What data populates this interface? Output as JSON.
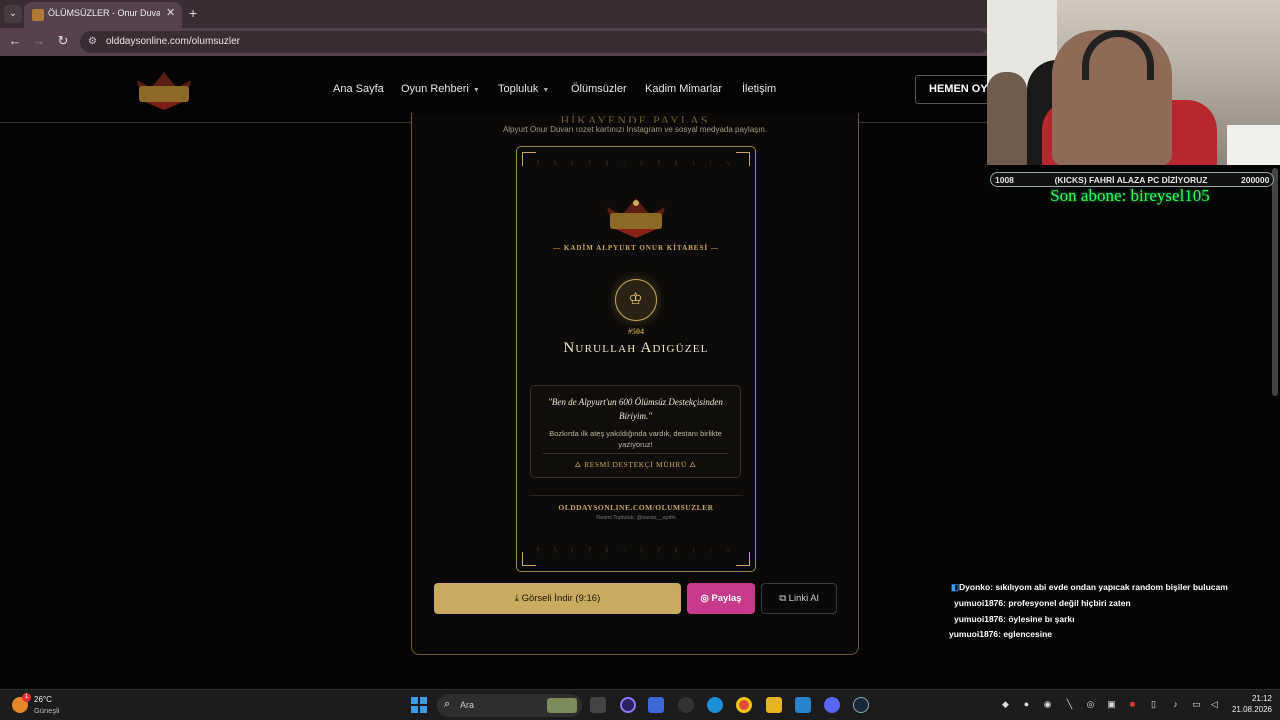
{
  "browser": {
    "tab_title": "ÖLÜMSÜZLER - Onur Duvarı | O",
    "url": "olddaysonline.com/olumsuzler",
    "new_tab_symbol": "+",
    "close_symbol": "✕"
  },
  "site_nav": {
    "logo_text": "OLD DAYS",
    "links": [
      "Ana Sayfa",
      "Oyun Rehberi",
      "Topluluk",
      "Ölümsüzler",
      "Kadim Mimarlar",
      "İletişim"
    ],
    "play_button": "HEMEN OYNA"
  },
  "share_section": {
    "heading": "HİKAYENDE PAYLAŞ",
    "description": "Alpyurt Onur Duvarı rozet kartınızı Instagram ve sosyal medyada paylaşın."
  },
  "card": {
    "logo_text": "OLD DAYS",
    "subtitle": "— KADİM ALPYURT ONUR KİTABESİ —",
    "crown_icon": "♔",
    "member_number": "#504",
    "member_name": "Nurullah Adigüzel",
    "quote": "\"Ben de Alpyurt'un 600 Ölümsüz Destekçisinden Biriyim.\"",
    "quote_sub": "Bozkırda ilk ateş yakıldığında vardık, destanı birlikte yazıyoruz!",
    "seal": "🜂 RESMİ DESTEKÇİ MÜHRÜ 🜂",
    "url": "OLDDAYSONLINE.COM/OLUMSUZLER",
    "community": "Resmi Topluluk: @savas__aydin",
    "runes": "ᚠ ᚢ ᚦ ᚨ ᚱ ᚲ ᚷ ᚹ ᚺ ᚾ ᛁ ᛃ"
  },
  "actions": {
    "download": "Görseli İndir (9:16)",
    "share": "Paylaş",
    "copy": "Linki Al"
  },
  "stream": {
    "goal_left": "1008",
    "goal_title": "(KICKS) FAHRİ ALAZA PC DİZİYORUZ",
    "goal_right": "200000",
    "last_sub": "Son abone: bireysel105",
    "chat": [
      {
        "user": "Dyonko",
        "msg": ": sıkılıyom abi evde ondan yapıcak random bişiler bulucam"
      },
      {
        "user": "yumuoi1876",
        "msg": ": profesyonel değil hiçbiri zaten"
      },
      {
        "user": "yumuoi1876",
        "msg": ": öylesine bı şarkı"
      },
      {
        "user": "yumuoi1876",
        "msg": ": eglencesine"
      }
    ]
  },
  "taskbar": {
    "weather_badge": "1",
    "temperature": "26°C",
    "weather_desc": "Güneşli",
    "search_placeholder": "Ara",
    "time": "21:12",
    "date": "21.08.2026"
  },
  "colors": {
    "gold": "#c8ab5f",
    "instagram_pink": "#c83a8c",
    "sub_green": "#2cff4a"
  }
}
